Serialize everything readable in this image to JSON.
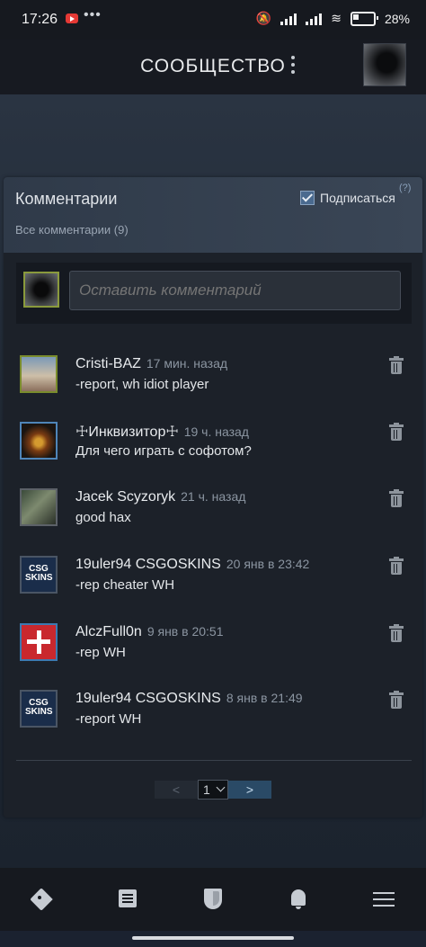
{
  "status_bar": {
    "time": "17:26",
    "dots": "•••",
    "battery": "28%"
  },
  "header": {
    "title": "СООБЩЕСТВО"
  },
  "comments_panel": {
    "title": "Комментарии",
    "all_comments": "Все комментарии (9)",
    "subscribe_label": "Подписаться",
    "subscribe_checked": true,
    "help": "(?)",
    "compose_placeholder": "Оставить комментарий",
    "comments": [
      {
        "author": "Cristi-BAZ",
        "time": "17 мин. назад",
        "text": "-report, wh idiot player"
      },
      {
        "author": "☩Инквизитор☩",
        "time": "19 ч. назад",
        "text": "Для чего играть с софотом?"
      },
      {
        "author": "Jacek Scyzoryk",
        "time": "21 ч. назад",
        "text": "good hax"
      },
      {
        "author": "19uler94 CSGOSKINS",
        "time": "20 янв в 23:42",
        "text": "-rep cheater WH",
        "avatar_text": "CSG SKINS"
      },
      {
        "author": "AlczFull0n",
        "time": "9 янв в 20:51",
        "text": "-rep WH"
      },
      {
        "author": "19uler94 CSGOSKINS",
        "time": "8 янв в 21:49",
        "text": "-report WH",
        "avatar_text": "CSG SKINS"
      }
    ],
    "pager": {
      "prev": "<",
      "page": "1",
      "next": ">"
    }
  },
  "bottom_nav": {
    "items": [
      {
        "icon": "tag-icon"
      },
      {
        "icon": "news-icon"
      },
      {
        "icon": "shield-icon"
      },
      {
        "icon": "bell-icon"
      },
      {
        "icon": "menu-icon"
      }
    ]
  },
  "colors": {
    "accent": "#2a4a66",
    "background": "#1b2230",
    "header": "#171a21"
  }
}
